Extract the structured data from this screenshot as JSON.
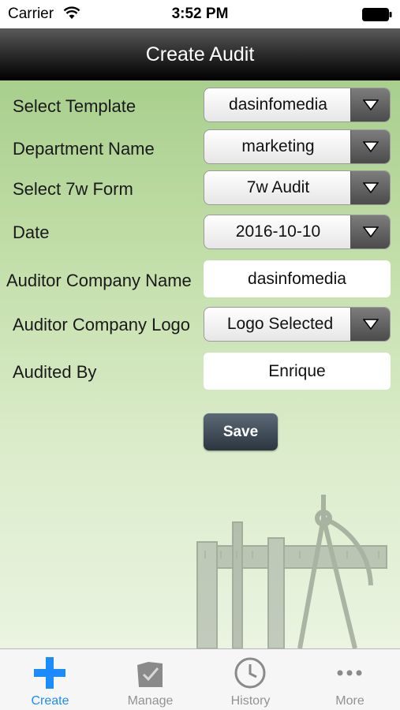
{
  "status_bar": {
    "carrier": "Carrier",
    "time": "3:52 PM"
  },
  "nav": {
    "title": "Create Audit"
  },
  "form": {
    "select_template": {
      "label": "Select Template",
      "value": "dasinfomedia"
    },
    "department_name": {
      "label": "Department Name",
      "value": "marketing"
    },
    "select_7w_form": {
      "label": "Select 7w Form",
      "value": "7w Audit"
    },
    "date": {
      "label": "Date",
      "value": "2016-10-10"
    },
    "auditor_company_name": {
      "label": "Auditor Company Name",
      "value": "dasinfomedia"
    },
    "auditor_company_logo": {
      "label": "Auditor Company Logo",
      "value": "Logo Selected"
    },
    "audited_by": {
      "label": "Audited By",
      "value": "Enrique"
    }
  },
  "save_label": "Save",
  "tabs": [
    {
      "label": "Create",
      "icon": "plus-icon",
      "active": true
    },
    {
      "label": "Manage",
      "icon": "folder-check-icon",
      "active": false
    },
    {
      "label": "History",
      "icon": "clock-icon",
      "active": false
    },
    {
      "label": "More",
      "icon": "more-dots-icon",
      "active": false
    }
  ],
  "colors": {
    "accent": "#1a8cff",
    "nav_bg": "#000000",
    "content_bg": "#c6e0ad"
  }
}
